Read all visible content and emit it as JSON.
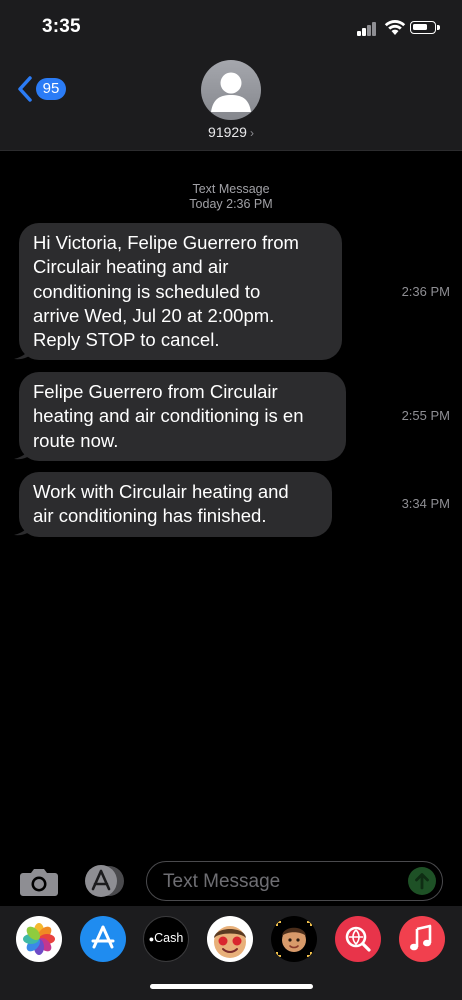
{
  "status_bar": {
    "time": "3:35"
  },
  "nav": {
    "back_badge": "95",
    "contact_name": "91929",
    "contact_chevron": "›"
  },
  "thread": {
    "service_label": "Text Message",
    "timestamp": "Today 2:36 PM"
  },
  "messages": [
    {
      "lines": [
        "Hi Victoria, Felipe Guerrero from",
        "Circulair heating and air",
        "conditioning is scheduled to",
        "arrive Wed, Jul 20 at 2:00pm.",
        "Reply STOP to cancel."
      ],
      "time": "2:36 PM"
    },
    {
      "lines": [
        "Felipe Guerrero from Circulair",
        "heating and air conditioning is en",
        "route now."
      ],
      "time": "2:55 PM"
    },
    {
      "lines": [
        "Work with Circulair heating and",
        "air conditioning has finished."
      ],
      "time": "3:34 PM"
    }
  ],
  "compose": {
    "placeholder": "Text Message"
  },
  "app_drawer": {
    "apps": [
      {
        "icon": "photos-icon",
        "label": ""
      },
      {
        "icon": "app-store-icon",
        "label": ""
      },
      {
        "icon": "apple-cash-icon",
        "label": "Cash"
      },
      {
        "icon": "memoji-stickers-icon",
        "label": ""
      },
      {
        "icon": "memoji-icon",
        "label": ""
      },
      {
        "icon": "web-search-icon",
        "label": ""
      },
      {
        "icon": "music-icon",
        "label": ""
      }
    ]
  },
  "colors": {
    "background": "#000000",
    "nav_background": "#1c1c1e",
    "bubble": "#2c2c2e",
    "accent": "#2b7cf6",
    "secondary_text": "#8e8e93"
  }
}
